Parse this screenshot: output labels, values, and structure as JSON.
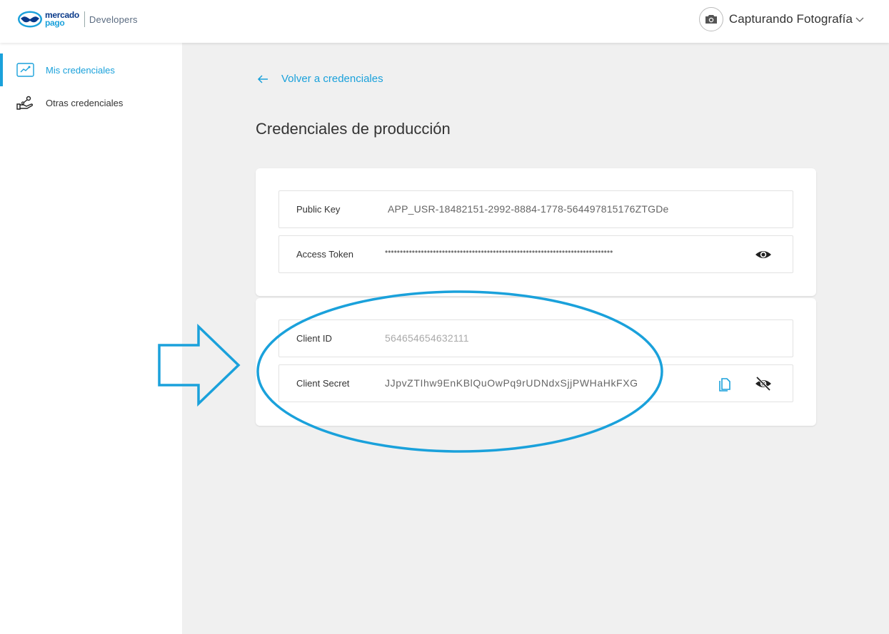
{
  "header": {
    "logo_line1": "mercado",
    "logo_line2": "pago",
    "product": "Developers",
    "account_name": "Capturando Fotografía",
    "account_icon": "camera-icon"
  },
  "sidebar": {
    "items": [
      {
        "label": "Mis credenciales",
        "icon": "credentials-icon",
        "active": true
      },
      {
        "label": "Otras credenciales",
        "icon": "hand-share-icon",
        "active": false
      }
    ]
  },
  "main": {
    "back_label": "Volver a credenciales",
    "title": "Credenciales de producción",
    "card1": [
      {
        "key": "Public Key",
        "value": "APP_USR-18482151-2992-8884-1778-564497815176ZTGDe"
      },
      {
        "key": "Access Token",
        "value": "••••••••••••••••••••••••••••••••••••••••••••••••••••••••••••••••••••••••••••"
      }
    ],
    "card2": [
      {
        "key": "Client ID",
        "value": "564654654632111"
      },
      {
        "key": "Client Secret",
        "value": "JJpvZTIhw9EnKBlQuOwPq9rUDNdxSjjPWHaHkFXG"
      }
    ]
  },
  "colors": {
    "accent": "#1aa1db",
    "brand_dark": "#0a3a8a",
    "background": "#f0f0f0",
    "annotation": "#1aa1db"
  }
}
